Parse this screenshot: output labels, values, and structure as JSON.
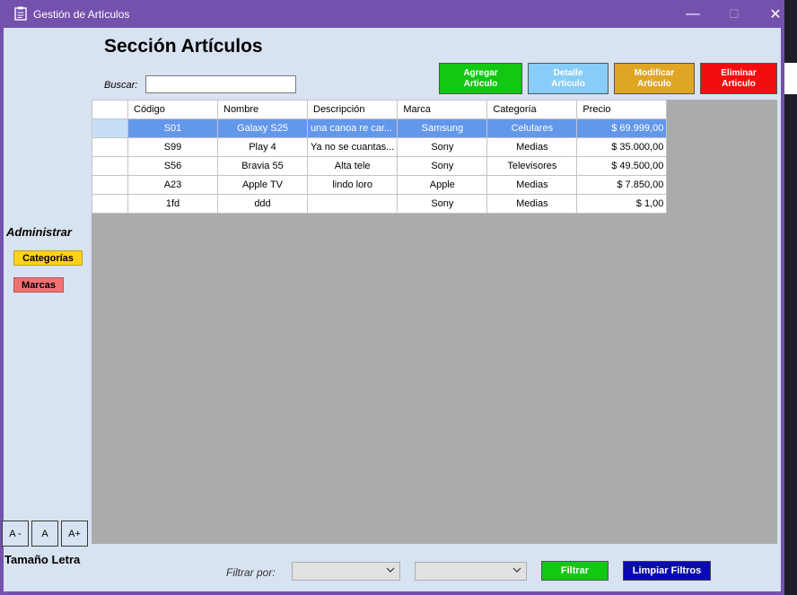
{
  "window": {
    "title": "Gestión de Artículos",
    "icon": "clipboard-icon",
    "controls": {
      "minimize": "—",
      "maximize": "☐",
      "close": "✕"
    },
    "accent_color": "#7451ad"
  },
  "header": {
    "title": "Sección Artículos"
  },
  "search": {
    "label": "Buscar:",
    "value": "",
    "placeholder": ""
  },
  "actions": {
    "agregar": "Agregar\nArticulo",
    "detalle": "Detalle\nArticulo",
    "modificar": "Modificar\nArticulo",
    "eliminar": "Eliminar\nArticulo"
  },
  "table": {
    "columns": [
      "Código",
      "Nombre",
      "Descripción",
      "Marca",
      "Categoría",
      "Precio"
    ],
    "rows": [
      {
        "codigo": "S01",
        "nombre": "Galaxy S25",
        "descripcion": "una canoa re car...",
        "marca": "Samsung",
        "categoria": "Celulares",
        "precio": "$ 69.999,00",
        "selected": true
      },
      {
        "codigo": "S99",
        "nombre": "Play 4",
        "descripcion": "Ya no se cuantas...",
        "marca": "Sony",
        "categoria": "Medias",
        "precio": "$ 35.000,00",
        "selected": false
      },
      {
        "codigo": "S56",
        "nombre": "Bravia 55",
        "descripcion": "Alta tele",
        "marca": "Sony",
        "categoria": "Televisores",
        "precio": "$ 49.500,00",
        "selected": false
      },
      {
        "codigo": "A23",
        "nombre": "Apple TV",
        "descripcion": "lindo loro",
        "marca": "Apple",
        "categoria": "Medias",
        "precio": "$ 7.850,00",
        "selected": false
      },
      {
        "codigo": "1fd",
        "nombre": "ddd",
        "descripcion": "",
        "marca": "Sony",
        "categoria": "Medias",
        "precio": "$ 1,00",
        "selected": false
      }
    ]
  },
  "sidebar": {
    "admin_label": "Administrar",
    "categorias": "Categorías",
    "marcas": "Marcas",
    "font_size": {
      "decrease": "A -",
      "normal": "A",
      "increase": "A+",
      "label": "Tamaño Letra"
    }
  },
  "filter": {
    "label": "Filtrar por:",
    "select1_value": "",
    "select2_value": "",
    "apply": "Filtrar",
    "clear": "Limpiar Filtros"
  }
}
